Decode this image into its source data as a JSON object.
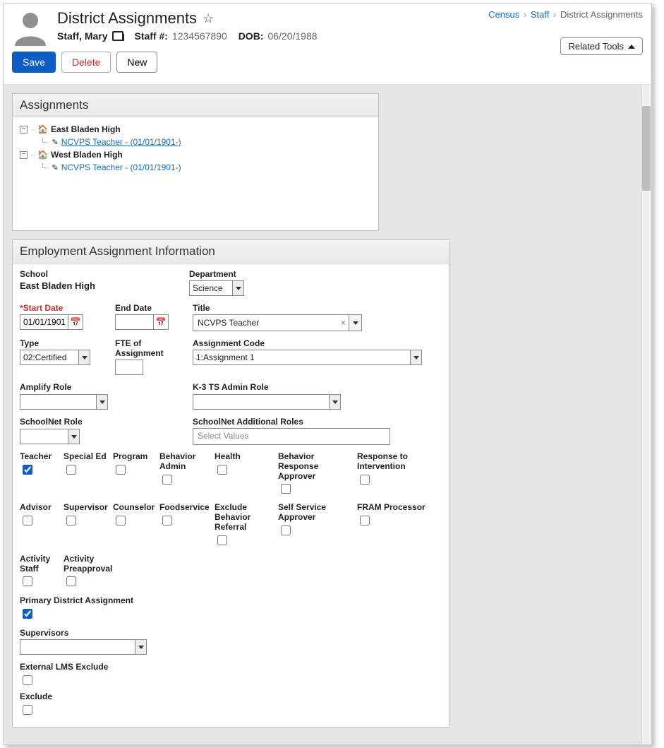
{
  "header": {
    "title": "District Assignments",
    "staff_name": "Staff, Mary",
    "staff_num_label": "Staff #:",
    "staff_num": "1234567890",
    "dob_label": "DOB:",
    "dob": "06/20/1988"
  },
  "breadcrumb": {
    "a": "Census",
    "b": "Staff",
    "c": "District Assignments"
  },
  "related_tools": "Related Tools",
  "actions": {
    "save": "Save",
    "delete": "Delete",
    "new": "New"
  },
  "assignments": {
    "panel_title": "Assignments",
    "nodes": [
      {
        "label": "East Bladen High",
        "child": "NCVPS Teacher - (01/01/1901-)",
        "selected": true
      },
      {
        "label": "West Bladen High",
        "child": "NCVPS Teacher - (01/01/1901-)",
        "selected": false
      }
    ]
  },
  "form": {
    "panel_title": "Employment Assignment Information",
    "school_label": "School",
    "school_value": "East Bladen High",
    "department_label": "Department",
    "department_value": "Science",
    "start_date_label": "Start Date",
    "start_date_value": "01/01/1901",
    "end_date_label": "End Date",
    "end_date_value": "",
    "title_label": "Title",
    "title_value": "NCVPS Teacher",
    "type_label": "Type",
    "type_value": "02:Certified",
    "fte_label": "FTE of Assignment",
    "fte_value": "",
    "assignment_code_label": "Assignment Code",
    "assignment_code_value": "1:Assignment 1",
    "amplify_label": "Amplify Role",
    "k3_label": "K-3 TS Admin Role",
    "schoolnet_label": "SchoolNet Role",
    "schoolnet_add_label": "SchoolNet Additional Roles",
    "schoolnet_add_placeholder": "Select Values",
    "checks": {
      "teacher": "Teacher",
      "special_ed": "Special Ed",
      "program": "Program",
      "behavior_admin": "Behavior Admin",
      "health": "Health",
      "behavior_response": "Behavior Response Approver",
      "rti": "Response to Intervention",
      "advisor": "Advisor",
      "supervisor": "Supervisor",
      "counselor": "Counselor",
      "foodservice": "Foodservice",
      "exclude_behavior": "Exclude Behavior Referral",
      "self_service": "Self Service Approver",
      "fram": "FRAM Processor",
      "activity_staff": "Activity Staff",
      "activity_preapproval": "Activity Preapproval"
    },
    "primary_label": "Primary District Assignment",
    "supervisors_label": "Supervisors",
    "ext_lms_label": "External LMS Exclude",
    "exclude_label": "Exclude"
  }
}
